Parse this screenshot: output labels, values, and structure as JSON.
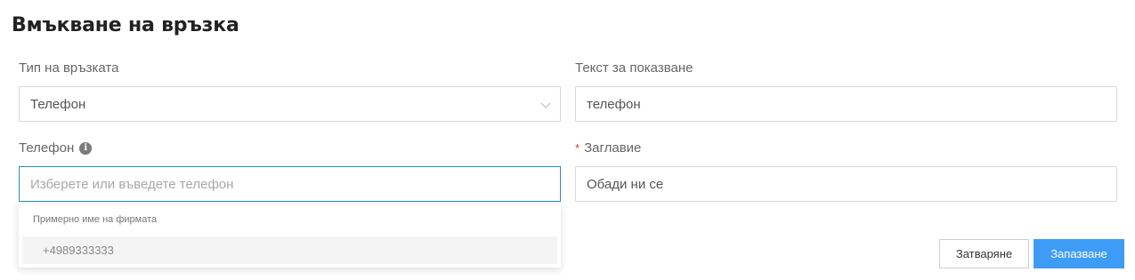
{
  "dialog": {
    "title": "Вмъкване на връзка"
  },
  "link_type": {
    "label": "Тип на връзката",
    "value": "Телефон"
  },
  "display_text": {
    "label": "Текст за показване",
    "value": "телефон"
  },
  "phone": {
    "label": "Телефон",
    "placeholder": "Изберете или въведете телефон"
  },
  "title_field": {
    "required_mark": "*",
    "label": "Заглавие",
    "value": "Обади ни се"
  },
  "phone_dropdown": {
    "group_label": "Примерно име на фирмата",
    "options": [
      "+4989333333"
    ]
  },
  "buttons": {
    "close": "Затваряне",
    "save": "Запазване"
  },
  "colors": {
    "accent": "#3f9cf6",
    "focus_border": "#2a8fbd",
    "required": "#d9363e"
  }
}
